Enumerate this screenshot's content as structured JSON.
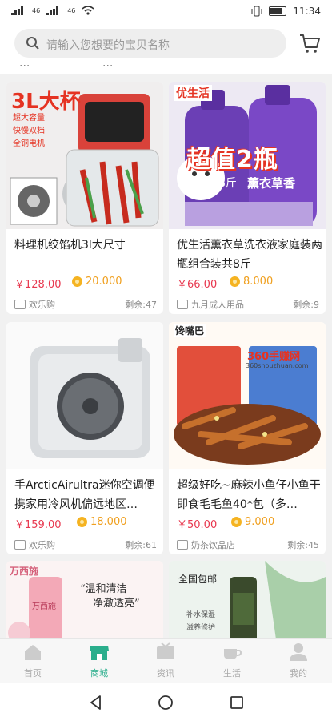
{
  "status": {
    "signal_left": "46",
    "signal_right": "46",
    "time": "11:34"
  },
  "search": {
    "placeholder": "请输入您想要的宝贝名称"
  },
  "tabs": [
    "...",
    "..."
  ],
  "products": [
    {
      "title": "料理机绞馅机3l大尺寸",
      "price": "￥128.00",
      "coins": "20.000",
      "shop": "欢乐购",
      "stock": "剩余:47",
      "image_text": [
        "3L大杯",
        "超大容量",
        "快慢双档",
        "全铜电机"
      ]
    },
    {
      "title": "优生活薰衣草洗衣液家庭装两瓶组合装共8斤",
      "price": "￥66.00",
      "coins": "8.000",
      "shop": "九月成人用品",
      "stock": "剩余:9",
      "image_text": [
        "优生活",
        "超值2瓶",
        "8斤",
        "薰衣草香"
      ]
    },
    {
      "title": "手ArcticAirultra迷你空调便携家用冷风机偏远地区…",
      "price": "￥159.00",
      "coins": "18.000",
      "shop": "欢乐购",
      "stock": "剩余:61",
      "image_text": []
    },
    {
      "title": "超级好吃~麻辣小鱼仔小鱼干即食毛毛鱼40*包（多…",
      "price": "￥50.00",
      "coins": "9.000",
      "shop": "奶茶饮品店",
      "stock": "剩余:45",
      "image_text": [
        "馋嘴巴",
        "360手赚网",
        "360shouzhuan.com"
      ]
    },
    {
      "title": "",
      "image_text": [
        "万西施",
        "“温和清洁",
        "净澈透亮”",
        "万西施"
      ]
    },
    {
      "title": "",
      "image_text": [
        "全国包邮",
        "补水保湿",
        "滋养修护"
      ]
    }
  ],
  "nav": [
    {
      "label": "首页",
      "icon": "home-icon",
      "active": false
    },
    {
      "label": "商城",
      "icon": "store-icon",
      "active": true
    },
    {
      "label": "资讯",
      "icon": "tv-icon",
      "active": false
    },
    {
      "label": "生活",
      "icon": "cup-icon",
      "active": false
    },
    {
      "label": "我的",
      "icon": "user-icon",
      "active": false
    }
  ],
  "colors": {
    "accent": "#2aae8c",
    "price": "#e8384f",
    "coin": "#f0a020"
  }
}
